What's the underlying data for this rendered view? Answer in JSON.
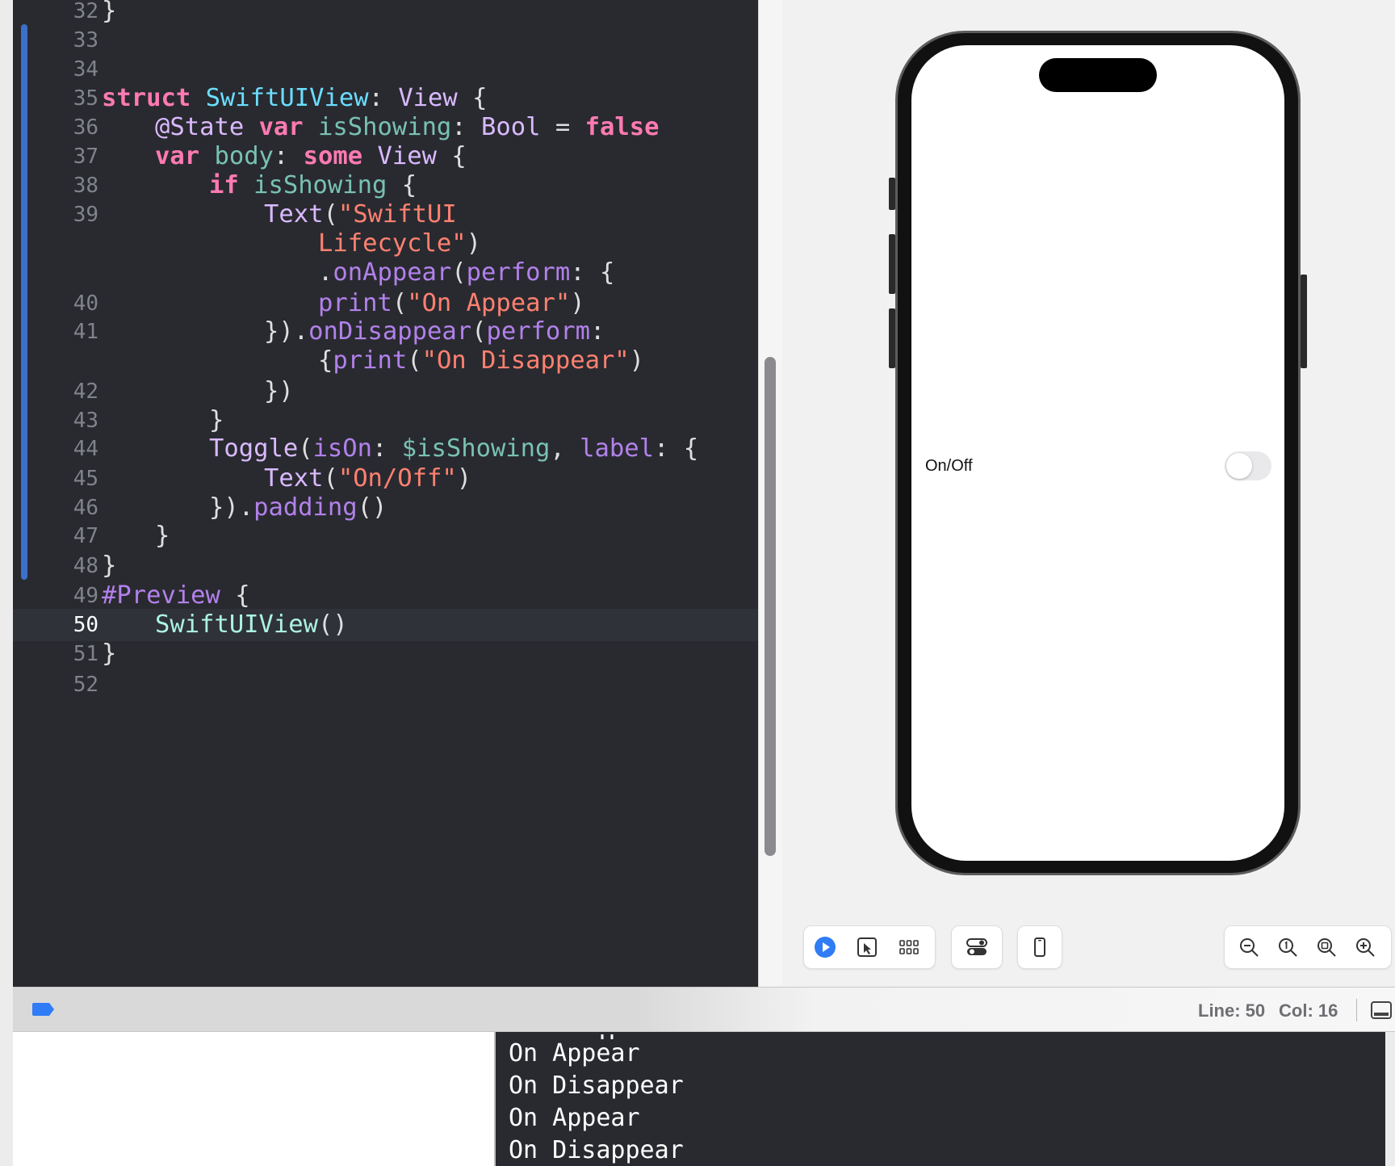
{
  "editor": {
    "lines": [
      {
        "n": "32"
      },
      {
        "n": "33"
      },
      {
        "n": "34"
      },
      {
        "n": "35"
      },
      {
        "n": "36"
      },
      {
        "n": "37"
      },
      {
        "n": "38"
      },
      {
        "n": "39"
      },
      {
        "n": "40"
      },
      {
        "n": "41"
      },
      {
        "n": "42"
      },
      {
        "n": "43"
      },
      {
        "n": "44"
      },
      {
        "n": "45"
      },
      {
        "n": "46"
      },
      {
        "n": "47"
      },
      {
        "n": "48"
      },
      {
        "n": "49"
      },
      {
        "n": "50"
      },
      {
        "n": "51"
      },
      {
        "n": "52"
      }
    ],
    "t": {
      "close_brace": "}",
      "struct_kw": "struct",
      "struct_name": "SwiftUIView",
      "colon": ":",
      "view": "View",
      "open_brace": "{",
      "state_attr": "@State",
      "var_kw": "var",
      "is_showing": "isShowing",
      "bool": "Bool",
      "eq": "=",
      "false_kw": "false",
      "body": "body",
      "some_kw": "some",
      "if_kw": "if",
      "text_fn": "Text",
      "paren_open": "(",
      "paren_close": ")",
      "str_swiftui": "\"SwiftUI",
      "str_lifecycle": "Lifecycle\"",
      "dot": ".",
      "on_appear": "onAppear",
      "perform": "perform",
      "print": "print",
      "str_on_appear": "\"On Appear\"",
      "close_paren_dot": "}).",
      "on_disappear": "onDisappear",
      "open_brace_print": "{",
      "str_on_disappear": "\"On Disappear\"",
      "close_paren": "})",
      "toggle": "Toggle",
      "is_on": "isOn",
      "binding": "$isShowing",
      "comma": ",",
      "label": "label",
      "str_on_off": "\"On/Off\"",
      "padding": "padding",
      "parens": "()",
      "preview": "#Preview",
      "swiftui_view_call": "SwiftUIView"
    }
  },
  "preview": {
    "toggle_label": "On/Off",
    "toggle_on": false
  },
  "toolbar": {
    "live_icon": "play-icon",
    "select_icon": "pointer-icon",
    "variants_icon": "grid-icon",
    "settings_icon": "toggles-icon",
    "device_icon": "phone-icon",
    "zoom_out_icon": "zoom-out-icon",
    "zoom_100_icon": "zoom-actual-icon",
    "zoom_fit_icon": "zoom-fit-icon",
    "zoom_in_icon": "zoom-in-icon"
  },
  "status": {
    "line_label": "Line: 50",
    "col_label": "Col: 16"
  },
  "console": {
    "lines": [
      "On Appear",
      "On Disappear",
      "On Appear",
      "On Disappear"
    ]
  },
  "colors": {
    "editor_bg": "#292a30",
    "keyword": "#ff7ab2",
    "string": "#ff8170",
    "accent": "#3b71ca"
  }
}
